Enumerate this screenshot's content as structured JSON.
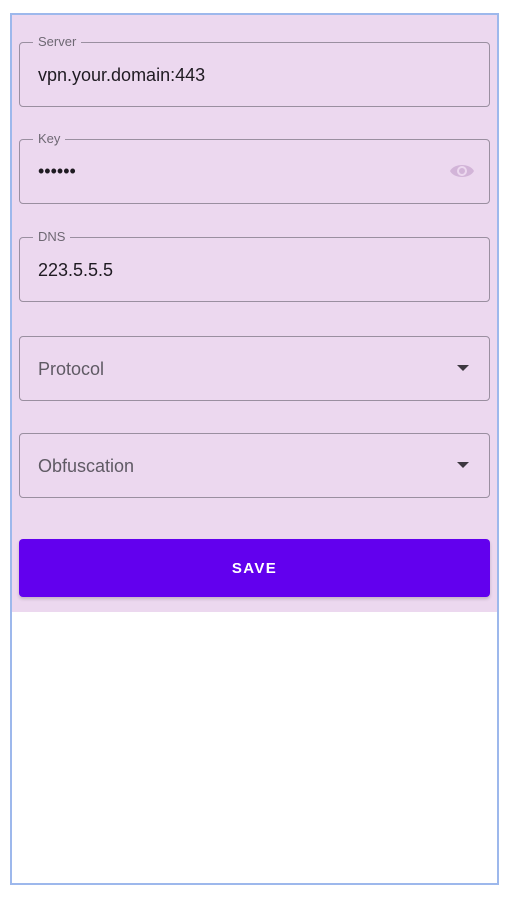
{
  "form": {
    "server": {
      "label": "Server",
      "value": "vpn.your.domain:443"
    },
    "key": {
      "label": "Key",
      "masked_value": "••••••",
      "visibility_icon": "eye-icon"
    },
    "dns": {
      "label": "DNS",
      "value": "223.5.5.5"
    },
    "protocol": {
      "placeholder": "Protocol",
      "icon": "dropdown-arrow-icon"
    },
    "obfuscation": {
      "placeholder": "Obfuscation",
      "icon": "dropdown-arrow-icon"
    },
    "save_label": "SAVE"
  },
  "colors": {
    "panel_background": "#ecd8ef",
    "primary_button": "#6200ee",
    "frame_border": "#9db8ec"
  }
}
